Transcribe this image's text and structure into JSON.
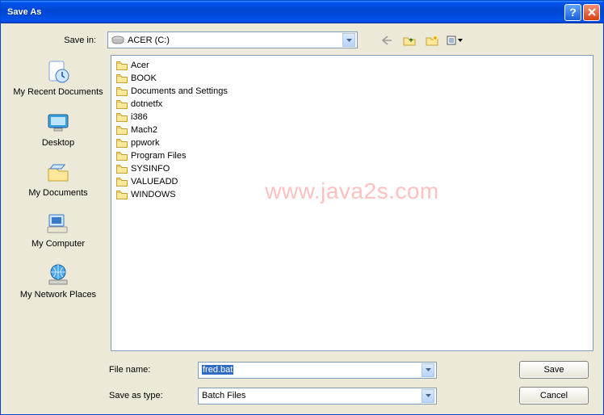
{
  "title": "Save As",
  "savein": {
    "label": "Save in:",
    "value": "ACER (C:)"
  },
  "places": {
    "recent": "My Recent Documents",
    "desktop": "Desktop",
    "mydocs": "My Documents",
    "mycomp": "My Computer",
    "network": "My Network Places"
  },
  "folders": [
    "Acer",
    "BOOK",
    "Documents and Settings",
    "dotnetfx",
    "i386",
    "Mach2",
    "ppwork",
    "Program Files",
    "SYSINFO",
    "VALUEADD",
    "WINDOWS"
  ],
  "filename": {
    "label": "File name:",
    "value": "fred.bat"
  },
  "filetype": {
    "label": "Save as type:",
    "value": "Batch Files"
  },
  "buttons": {
    "save": "Save",
    "cancel": "Cancel"
  },
  "watermark": "www.java2s.com"
}
